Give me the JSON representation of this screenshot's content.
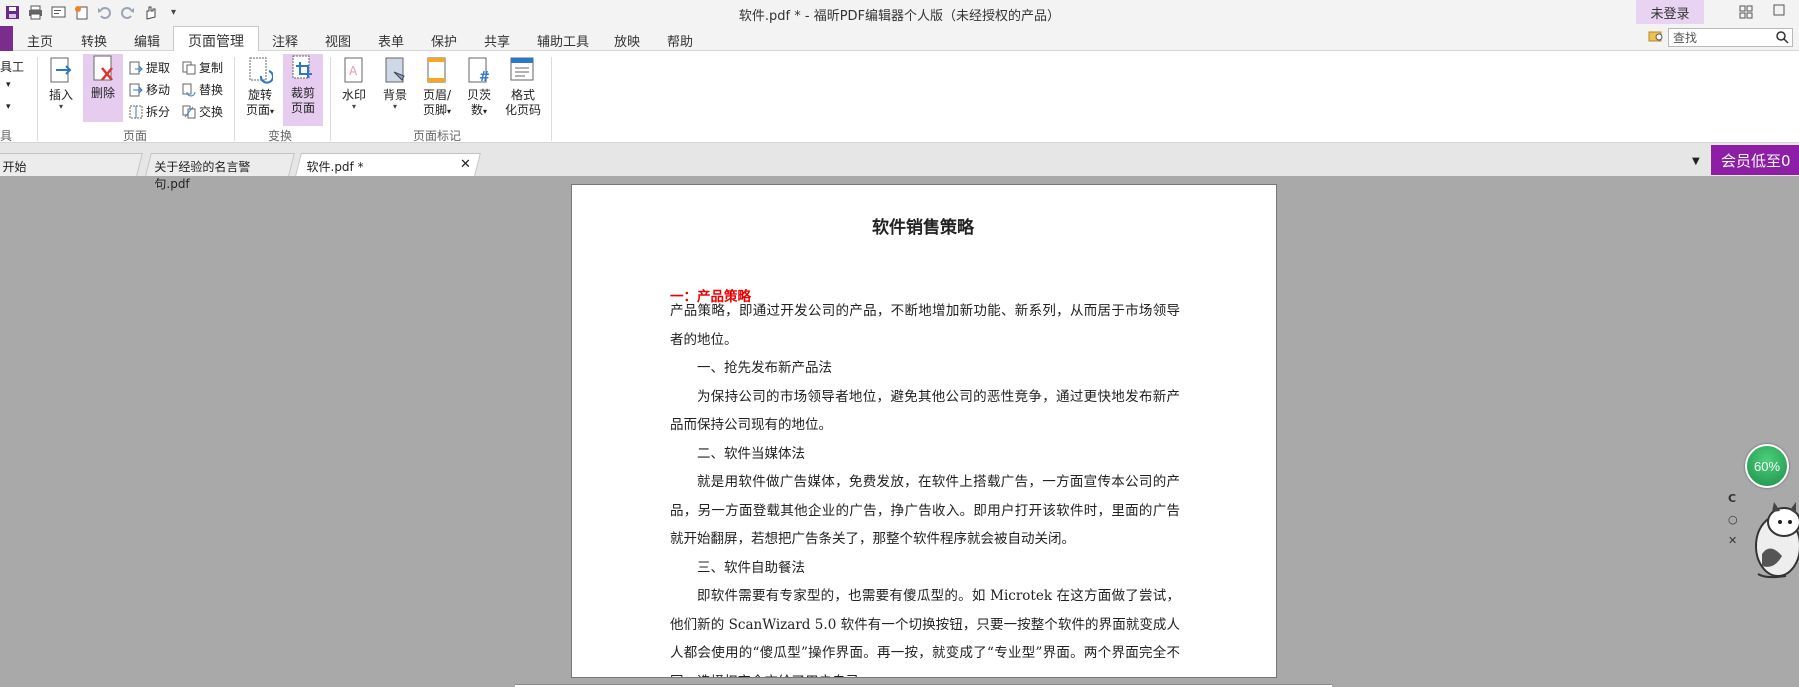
{
  "window": {
    "title": "软件.pdf * - 福昕PDF编辑器个人版（未经授权的产品）",
    "login_label": "未登录"
  },
  "menu": {
    "tabs": [
      "主页",
      "转换",
      "编辑",
      "页面管理",
      "注释",
      "视图",
      "表单",
      "保护",
      "共享",
      "辅助工具",
      "放映",
      "帮助"
    ],
    "active": "页面管理",
    "search_placeholder": "查找"
  },
  "ribbon": {
    "cut_left": [
      "具工",
      "▾",
      "▾",
      "具"
    ],
    "insert": "插入",
    "delete": "删除",
    "extract": "提取",
    "move": "移动",
    "split": "拆分",
    "copy": "复制",
    "replace": "替换",
    "swap": "交换",
    "group_page": "页面",
    "rotate_l1": "旋转",
    "rotate_l2": "页面",
    "crop_l1": "裁剪",
    "crop_l2": "页面",
    "group_transform": "变换",
    "watermark": "水印",
    "background": "背景",
    "header_l1": "页眉/",
    "header_l2": "页脚",
    "bates_l1": "贝茨",
    "bates_l2": "数",
    "format_l1": "格式",
    "format_l2": "化页码",
    "group_marks": "页面标记"
  },
  "doc_tabs": [
    {
      "label": "开始"
    },
    {
      "label": "关于经验的名言警句.pdf"
    },
    {
      "label": "软件.pdf *"
    }
  ],
  "promo_text": "会员低至0",
  "document": {
    "title": "软件销售策略",
    "section1": "一：产品策略",
    "paragraphs": [
      {
        "text": "产品策略，即通过开发公司的产品，不断地增加新功能、新系列，从而居于市场领导者的地位。",
        "indent": false
      },
      {
        "text": "一、抢先发布新产品法",
        "indent": true
      },
      {
        "text": "为保持公司的市场领导者地位，避免其他公司的恶性竞争，通过更快地发布新产品而保持公司现有的地位。",
        "indent": true
      },
      {
        "text": "二、软件当媒体法",
        "indent": true
      },
      {
        "text": "就是用软件做广告媒体，免费发放，在软件上搭载广告，一方面宣传本公司的产品，另一方面登载其他企业的广告，挣广告收入。即用户打开该软件时，里面的广告就开始翻屏，若想把广告条关了，那整个软件程序就会被自动关闭。",
        "indent": true
      },
      {
        "text": "三、软件自助餐法",
        "indent": true
      },
      {
        "text": "即软件需要有专家型的，也需要有傻瓜型的。如 Microtek 在这方面做了尝试，他们新的 ScanWizard 5.0 软件有一个切换按钮，只要一按整个软件的界面就变成人人都会使用的“傻瓜型”操作界面。再一按，就变成了“专业型”界面。两个界面完全不同，选择权完全交给了用户自己。",
        "indent": true
      }
    ]
  },
  "zoom": "60%",
  "colors": {
    "accent": "#7b2d8e",
    "promo": "#8e1ea6",
    "highlight": "#e6cdf0",
    "section_red": "#e00000"
  }
}
